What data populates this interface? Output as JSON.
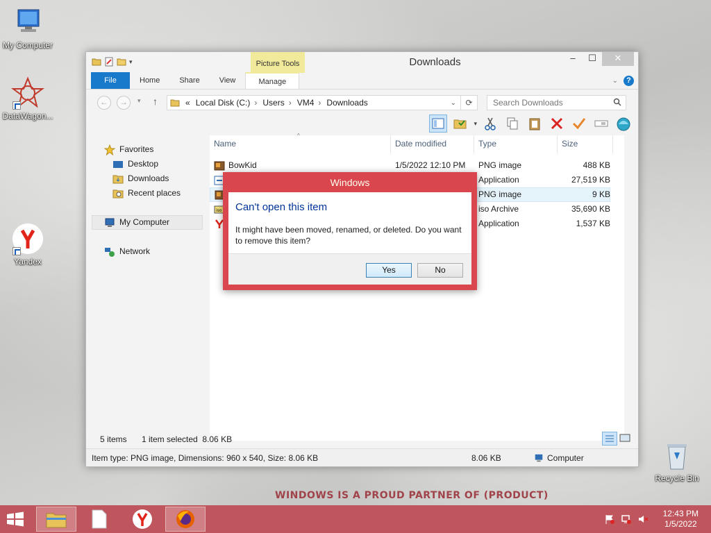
{
  "desktop": {
    "icons": [
      {
        "label": "My Computer"
      },
      {
        "label": "DataWagon..."
      },
      {
        "label": "Yandex"
      },
      {
        "label": "Recycle Bin"
      }
    ],
    "watermark": "WINDOWS IS A PROUD PARTNER OF (PRODUCT)"
  },
  "window": {
    "title": "Downloads",
    "contextual_tab_group": "Picture Tools",
    "tabs": [
      "File",
      "Home",
      "Share",
      "View",
      "Manage"
    ],
    "address": {
      "prefix": "«",
      "crumbs": [
        "Local Disk (C:)",
        "Users",
        "VM4",
        "Downloads"
      ]
    },
    "search": {
      "placeholder": "Search Downloads"
    },
    "nav": {
      "favorites": "Favorites",
      "desktop": "Desktop",
      "downloads": "Downloads",
      "recent": "Recent places",
      "computer": "My Computer",
      "network": "Network"
    },
    "columns": [
      "Name",
      "Date modified",
      "Type",
      "Size"
    ],
    "files": [
      {
        "name": "BowKid",
        "date": "1/5/2022 12:10 PM",
        "type": "PNG image",
        "size": "488 KB"
      },
      {
        "name": "",
        "date": "",
        "type": "Application",
        "size": "27,519 KB"
      },
      {
        "name": "",
        "date": "",
        "type": "PNG image",
        "size": "9 KB"
      },
      {
        "name": "",
        "date": "",
        "type": "iso Archive",
        "size": "35,690 KB"
      },
      {
        "name": "",
        "date": "",
        "type": "Application",
        "size": "1,537 KB"
      }
    ],
    "status": {
      "count": "5 items",
      "selected": "1 item selected  8.06 KB"
    },
    "details": {
      "info": "Item type: PNG image, Dimensions: 960 x 540, Size: 8.06 KB",
      "size": "8.06 KB",
      "location": "Computer"
    }
  },
  "dialog": {
    "title": "Windows",
    "heading": "Can't open this item",
    "message": "It might have been moved, renamed, or deleted. Do you want to remove this item?",
    "yes": "Yes",
    "no": "No"
  },
  "taskbar": {
    "time": "12:43 PM",
    "date": "1/5/2022"
  },
  "colors": {
    "accent": "#1979ca",
    "dialog_frame": "#d9464e",
    "taskbar": "#c0565d"
  }
}
